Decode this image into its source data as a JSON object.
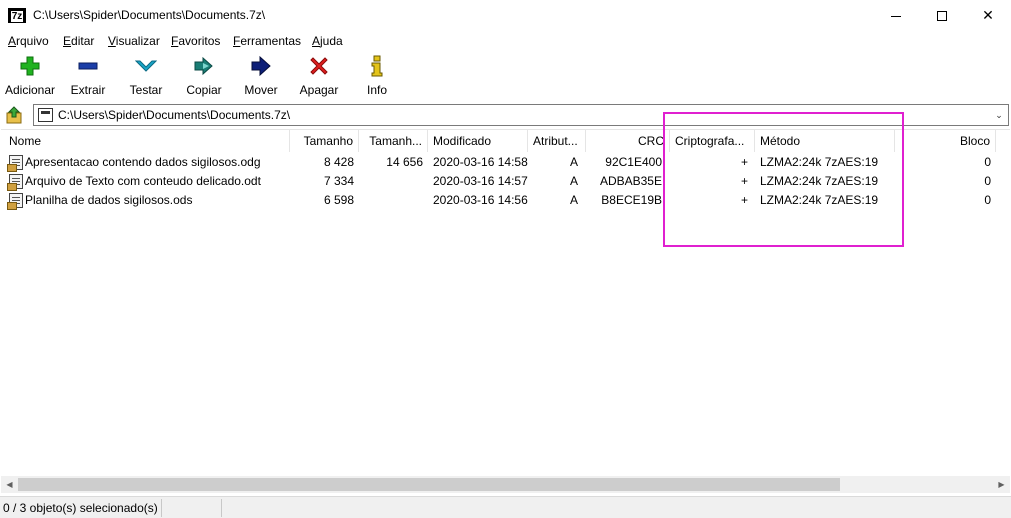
{
  "window": {
    "app_icon_text": "7z",
    "title": "C:\\Users\\Spider\\Documents\\Documents.7z\\",
    "close_glyph": "✕"
  },
  "menu": {
    "items": [
      {
        "first": "A",
        "rest": "rquivo"
      },
      {
        "first": "E",
        "rest": "ditar"
      },
      {
        "first": "V",
        "rest": "isualizar"
      },
      {
        "first": "F",
        "rest": "avoritos"
      },
      {
        "first": "F",
        "rest": "erramentas"
      },
      {
        "first": "A",
        "rest": "juda"
      }
    ]
  },
  "toolbar": {
    "add_label": "Adicionar",
    "extract_label": "Extrair",
    "test_label": "Testar",
    "copy_label": "Copiar",
    "move_label": "Mover",
    "delete_label": "Apagar",
    "info_label": "Info",
    "info_glyph": "i",
    "delete_glyph": "✖",
    "colors": {
      "add": "#1fb21f",
      "extract": "#1b3ea8",
      "test": "#19a6c8",
      "copy": "#1a7d75",
      "move": "#0d1f78",
      "delete": "#e01f1f",
      "info": "#e4c41a"
    }
  },
  "address": {
    "path": "C:\\Users\\Spider\\Documents\\Documents.7z\\",
    "dropdown_glyph": "⌄"
  },
  "columns": {
    "name": "Nome",
    "size": "Tamanho",
    "packed": "Tamanh...",
    "modified": "Modificado",
    "attributes": "Atribut...",
    "crc": "CRC",
    "encrypted": "Criptografa...",
    "method": "Método",
    "block": "Bloco"
  },
  "files": [
    {
      "name": "Apresentacao contendo dados sigilosos.odg",
      "size": "8 428",
      "packed": "14 656",
      "modified": "2020-03-16 14:58",
      "attributes": "A",
      "crc": "92C1E400",
      "encrypted": "+",
      "method": "LZMA2:24k 7zAES:19",
      "block": "0"
    },
    {
      "name": "Arquivo de Texto com conteudo delicado.odt",
      "size": "7 334",
      "packed": "",
      "modified": "2020-03-16 14:57",
      "attributes": "A",
      "crc": "ADBAB35E",
      "encrypted": "+",
      "method": "LZMA2:24k 7zAES:19",
      "block": "0"
    },
    {
      "name": "Planilha de dados sigilosos.ods",
      "size": "6 598",
      "packed": "",
      "modified": "2020-03-16 14:56",
      "attributes": "A",
      "crc": "B8ECE19B",
      "encrypted": "+",
      "method": "LZMA2:24k 7zAES:19",
      "block": "0"
    }
  ],
  "scrollbar": {
    "left_glyph": "◀",
    "right_glyph": "▶"
  },
  "status": {
    "selection": "0 / 3 objeto(s) selecionado(s)"
  },
  "highlight_color": "#e020d0"
}
